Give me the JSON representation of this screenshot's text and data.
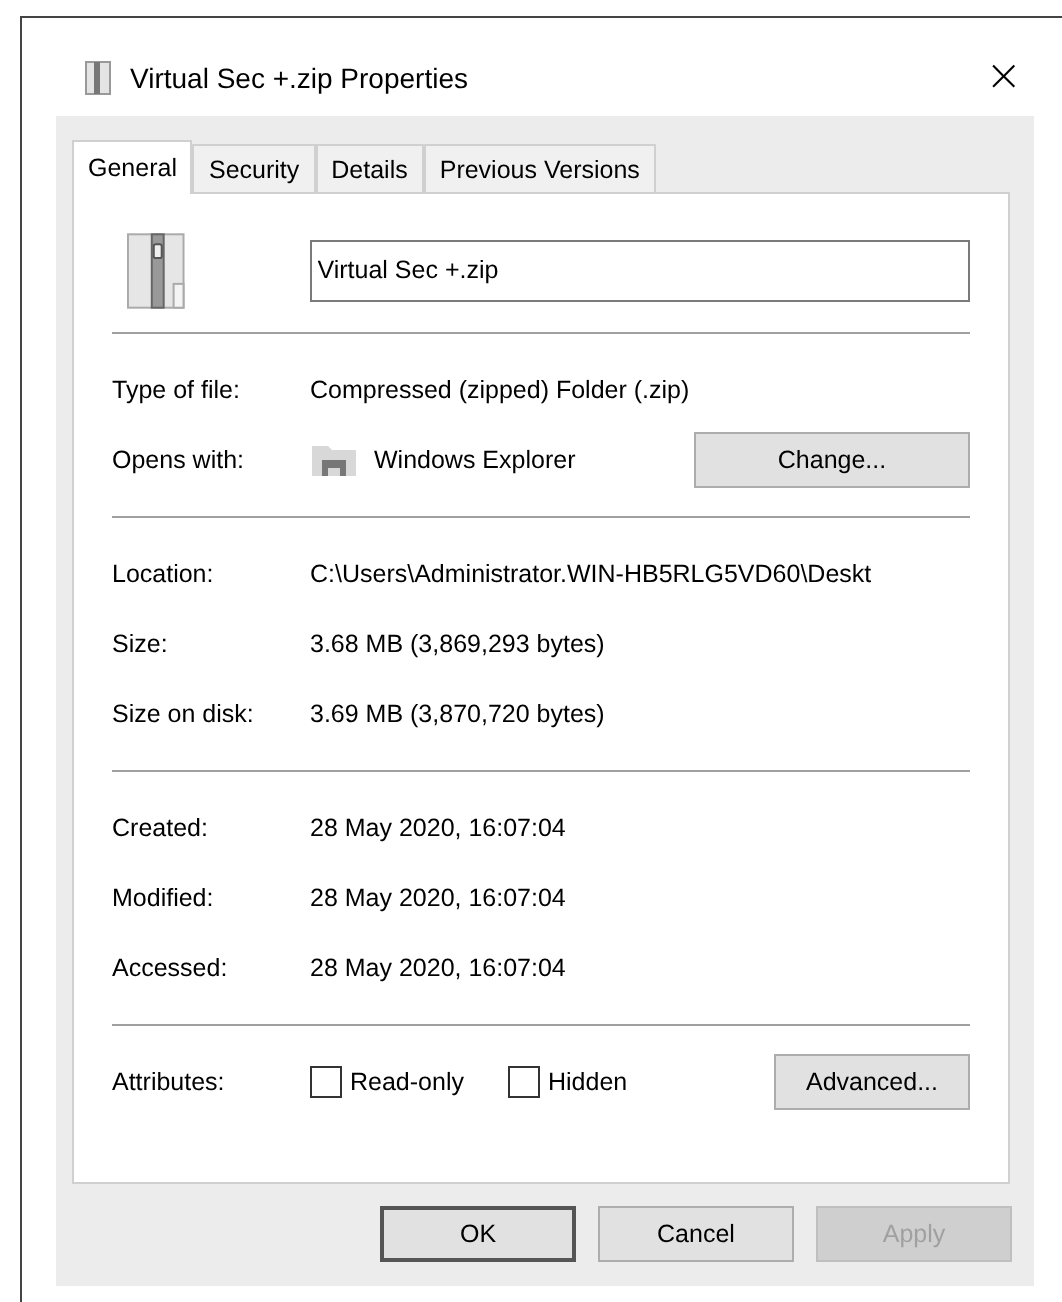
{
  "window": {
    "title": "Virtual Sec +.zip Properties",
    "close": "×"
  },
  "tabs": [
    {
      "label": "General",
      "selected": true
    },
    {
      "label": "Security",
      "selected": false
    },
    {
      "label": "Details",
      "selected": false
    },
    {
      "label": "Previous Versions",
      "selected": false
    }
  ],
  "file_name": {
    "value": "Virtual Sec +.zip"
  },
  "type_section": [
    {
      "label": "Type of file:",
      "value": "Compressed (zipped) Folder (.zip)"
    },
    {
      "label": "Opens with:",
      "value": "Windows Explorer",
      "kind": "app",
      "button": "Change..."
    }
  ],
  "location_section": [
    {
      "label": "Location:",
      "value": "C:\\Users\\Administrator.WIN-HB5RLG5VD60\\Deskt"
    },
    {
      "label": "Size:",
      "value": "3.68 MB (3,869,293 bytes)"
    },
    {
      "label": "Size on disk:",
      "value": "3.69 MB (3,870,720 bytes)"
    }
  ],
  "date_section": [
    {
      "label": "Created:",
      "value": "28 May 2020, 16:07:04"
    },
    {
      "label": "Modified:",
      "value": "28 May 2020, 16:07:04"
    },
    {
      "label": "Accessed:",
      "value": "28 May 2020, 16:07:04"
    }
  ],
  "attributes": {
    "label": "Attributes:",
    "options": [
      {
        "label": "Read-only",
        "checked": false
      },
      {
        "label": "Hidden",
        "checked": false
      }
    ],
    "button": "Advanced..."
  },
  "buttons": [
    {
      "label": "OK",
      "default": true,
      "disabled": false
    },
    {
      "label": "Cancel",
      "default": false,
      "disabled": false
    },
    {
      "label": "Apply",
      "default": false,
      "disabled": true
    }
  ]
}
